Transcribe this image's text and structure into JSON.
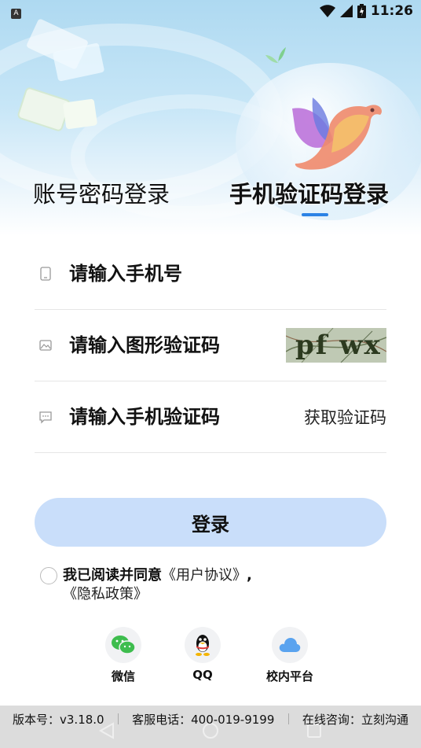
{
  "status_bar": {
    "time": "11:26",
    "notification_icon": "a-badge-icon",
    "icons": [
      "wifi-icon",
      "signal-icon",
      "battery-icon"
    ]
  },
  "tabs": {
    "password_login": "账号密码登录",
    "phone_login": "手机验证码登录",
    "active": "phone_login"
  },
  "form": {
    "phone_placeholder": "请输入手机号",
    "captcha_placeholder": "请输入图形验证码",
    "captcha_image_text": "pf wx",
    "sms_placeholder": "请输入手机验证码",
    "get_code_label": "获取验证码"
  },
  "login_button": {
    "label": "登录"
  },
  "agreement": {
    "prefix": "我已阅读并同意",
    "user_agreement": "《用户协议》",
    "separator": ",",
    "privacy_policy": "《隐私政策》",
    "checked": false
  },
  "third_party": {
    "wechat_label": "微信",
    "qq_label": "QQ",
    "campus_label": "校内平台"
  },
  "footer": {
    "version": "版本号：v3.18.0",
    "service_phone": "客服电话：400-019-9199",
    "consult_prefix": "在线咨询：",
    "consult_link": "立刻沟通"
  },
  "colors": {
    "accent": "#2b82e5",
    "login_button_bg": "#c9defa",
    "hero_top": "#aed9f1"
  }
}
